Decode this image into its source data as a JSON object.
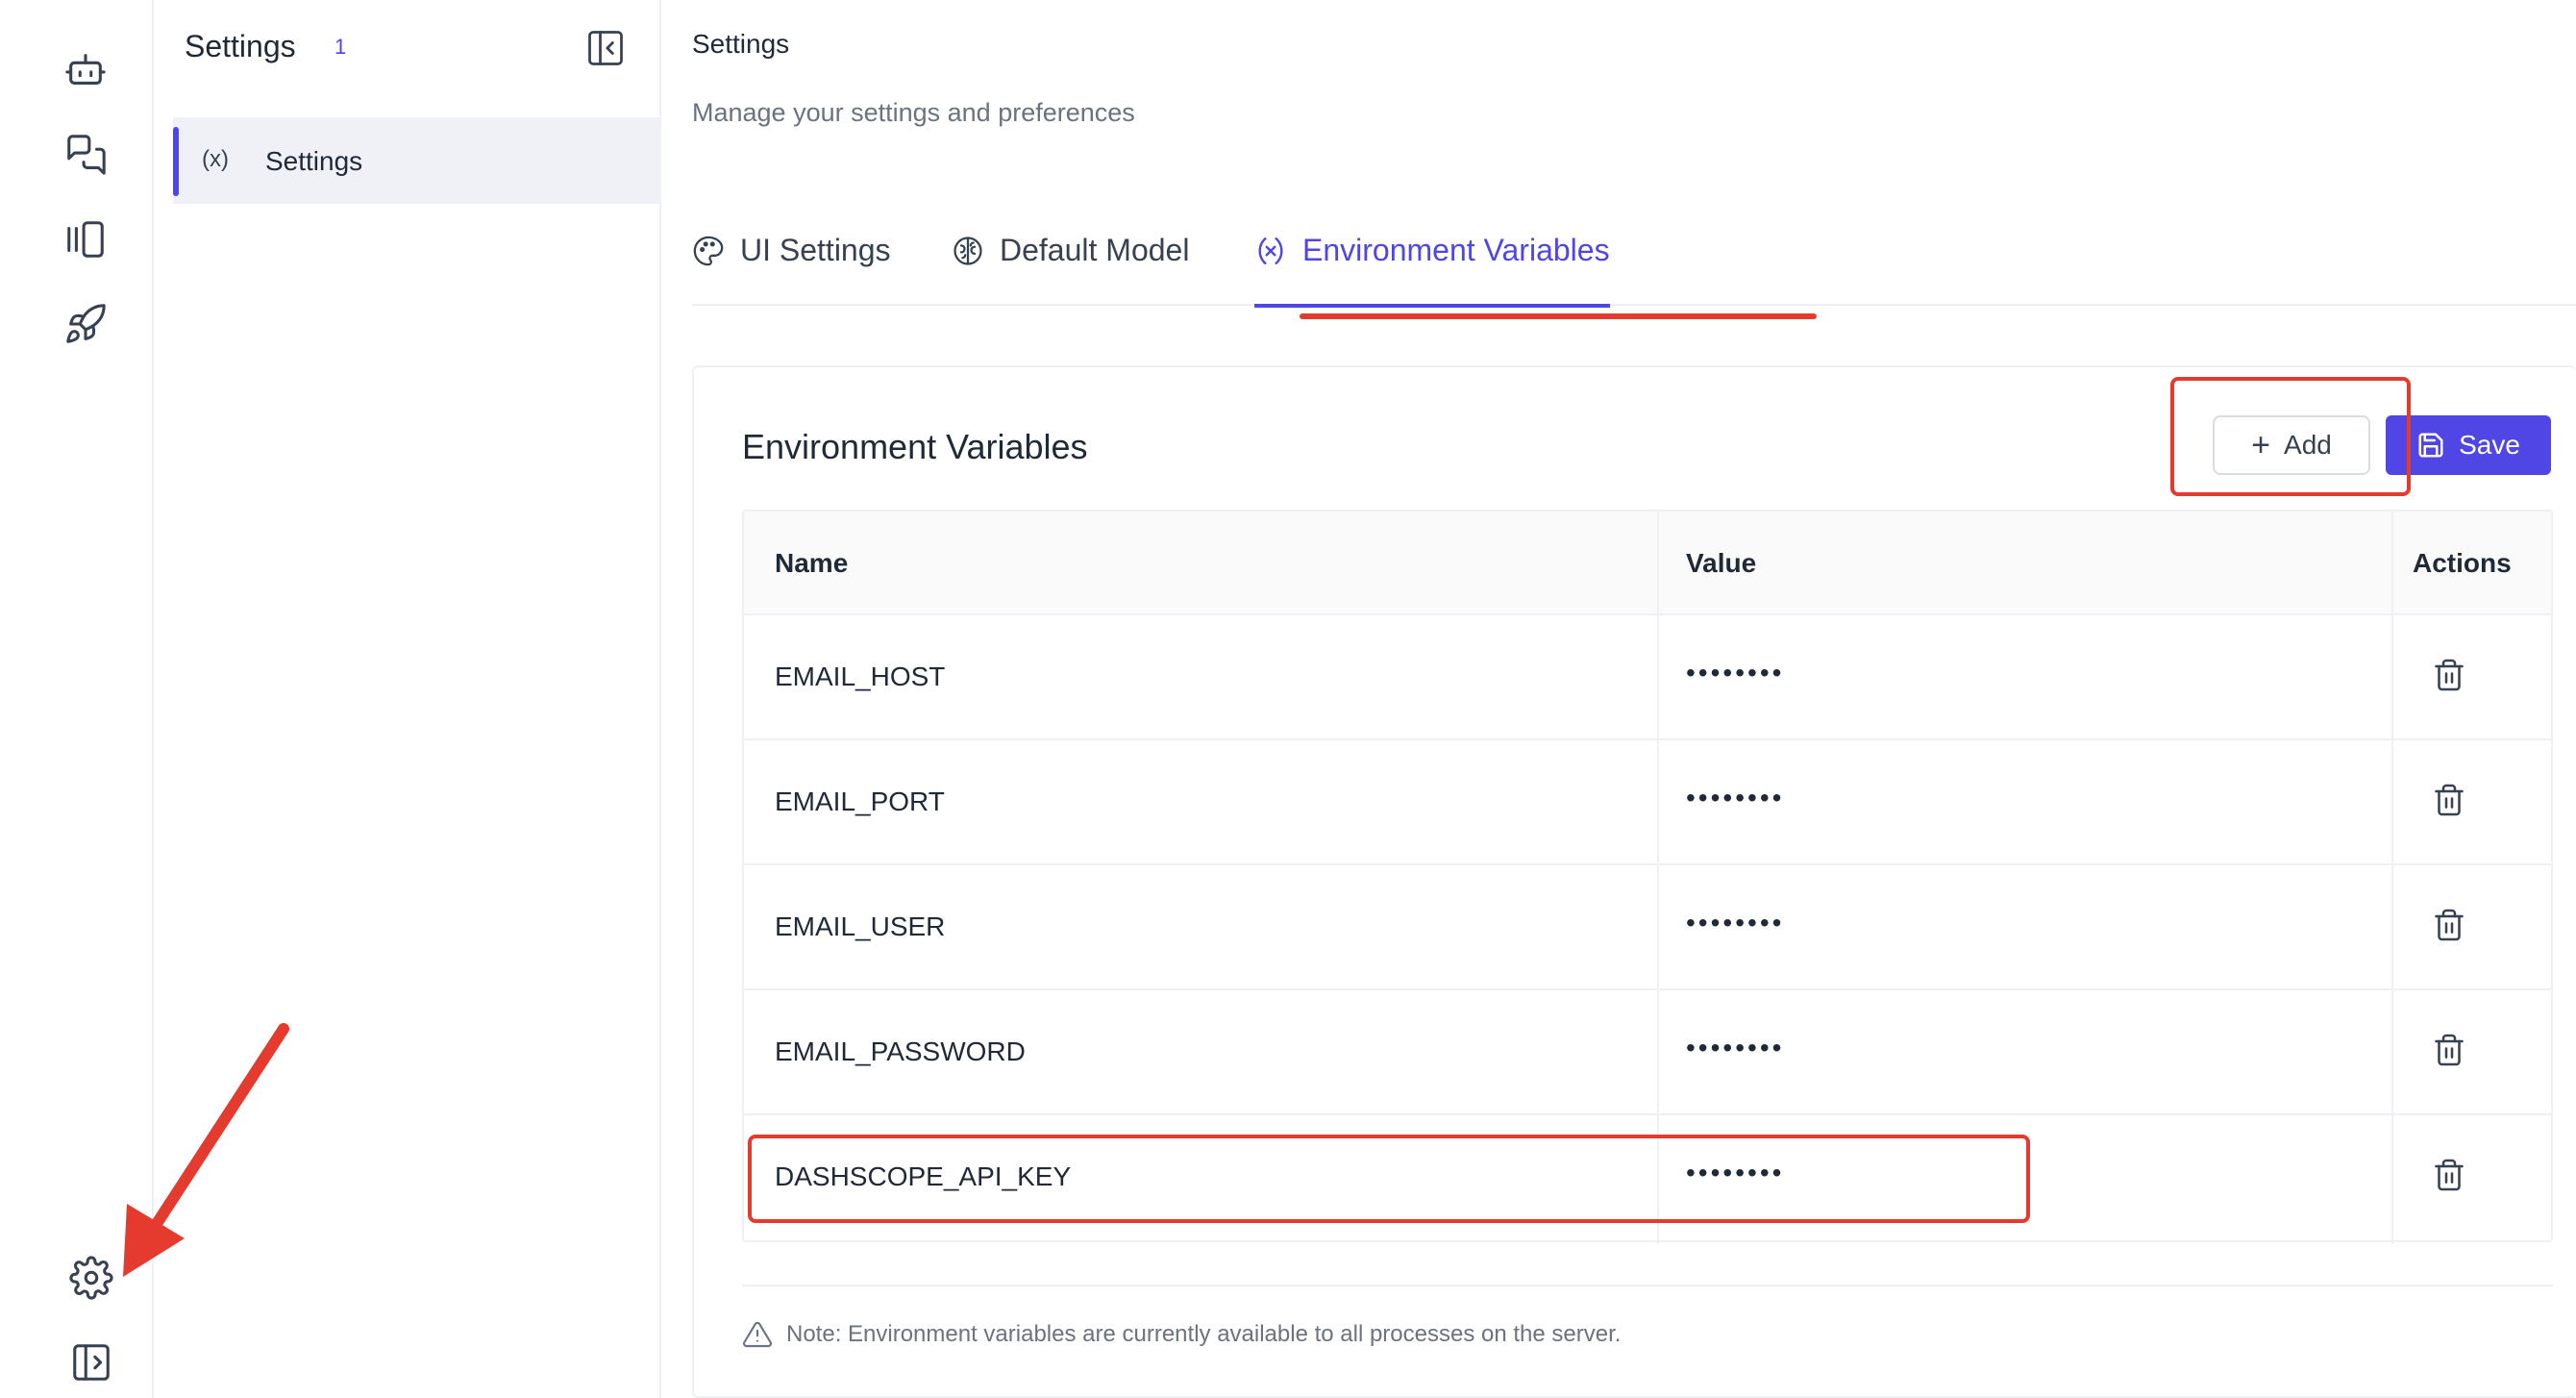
{
  "rail": {
    "items": [
      {
        "icon": "bot-icon"
      },
      {
        "icon": "chat-icon"
      },
      {
        "icon": "library-icon"
      },
      {
        "icon": "rocket-icon"
      }
    ],
    "bottom": [
      {
        "icon": "gear-icon"
      },
      {
        "icon": "sidebar-expand-icon"
      }
    ]
  },
  "sidebar": {
    "title": "Settings",
    "count": "1",
    "items": [
      {
        "icon_text": "(x)",
        "label": "Settings"
      }
    ]
  },
  "page": {
    "title": "Settings",
    "subtitle": "Manage your settings and preferences"
  },
  "tabs": [
    {
      "label": "UI Settings",
      "icon": "palette-icon"
    },
    {
      "label": "Default Model",
      "icon": "brain-icon"
    },
    {
      "label": "Environment Variables",
      "icon": "variable-icon",
      "active": true
    }
  ],
  "env": {
    "title": "Environment Variables",
    "add_label": "Add",
    "save_label": "Save",
    "columns": {
      "name": "Name",
      "value": "Value",
      "actions": "Actions"
    },
    "rows": [
      {
        "name": "EMAIL_HOST",
        "value": "••••••••"
      },
      {
        "name": "EMAIL_PORT",
        "value": "••••••••"
      },
      {
        "name": "EMAIL_USER",
        "value": "••••••••"
      },
      {
        "name": "EMAIL_PASSWORD",
        "value": "••••••••"
      },
      {
        "name": "DASHSCOPE_API_KEY",
        "value": "••••••••"
      }
    ],
    "note": "Note: Environment variables are currently available to all processes on the server."
  },
  "colors": {
    "accent": "#4f46e5",
    "annotation": "#e53a2e"
  }
}
